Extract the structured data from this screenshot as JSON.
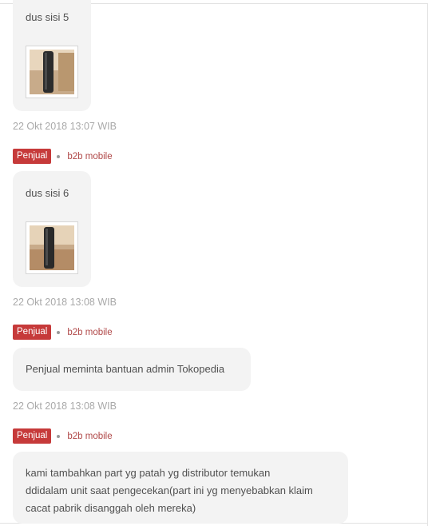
{
  "messages": [
    {
      "text": "dus sisi 5",
      "image_alt": "photo-thumbnail",
      "timestamp": "22 Okt 2018 13:07 WIB"
    },
    {
      "role": "Penjual",
      "sender": "b2b mobile",
      "text": "dus sisi 6",
      "image_alt": "photo-thumbnail",
      "timestamp": "22 Okt 2018 13:08 WIB"
    },
    {
      "role": "Penjual",
      "sender": "b2b mobile",
      "text": "Penjual meminta bantuan admin Tokopedia",
      "timestamp": "22 Okt 2018 13:08 WIB"
    },
    {
      "role": "Penjual",
      "sender": "b2b mobile",
      "text_lines": [
        "kami tambahkan part yg patah yg distributor temukan",
        "ddidalam unit saat pengecekan(part ini yg menyebabkan klaim",
        "cacat pabrik disanggah oleh mereka)"
      ]
    }
  ],
  "colors": {
    "badge": "#c63a3a",
    "sender": "#b04848",
    "bubble": "#f3f3f3",
    "timestamp": "#a9a9a9"
  }
}
